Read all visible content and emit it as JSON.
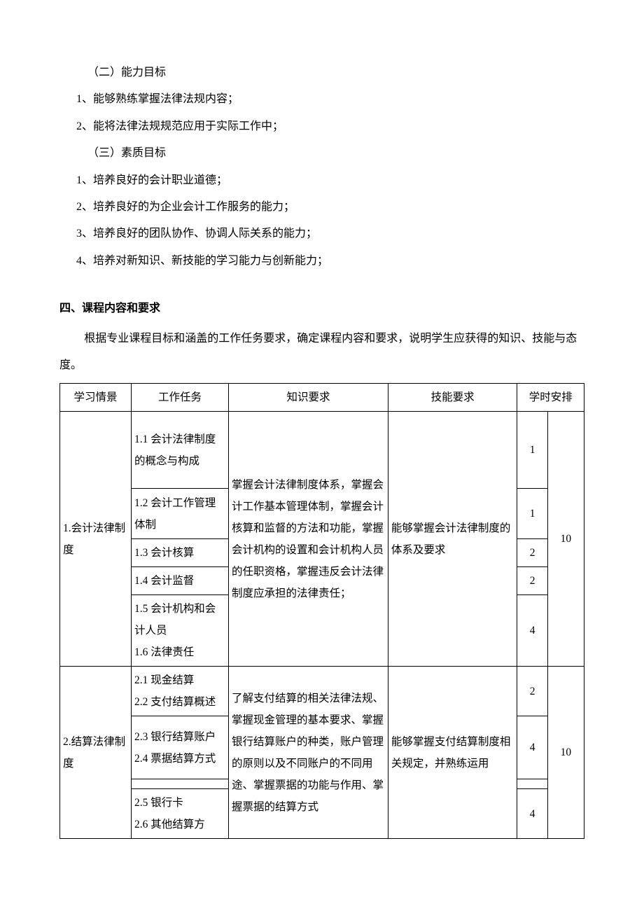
{
  "goals": {
    "ability_heading": "（二）能力目标",
    "ability_items": [
      "1、能够熟练掌握法律法规内容；",
      "2、能将法律法规规范应用于实际工作中；"
    ],
    "quality_heading": "（三）素质目标",
    "quality_items": [
      "1、培养良好的会计职业道德；",
      "2、培养良好的为企业会计工作服务的能力；",
      "3、培养良好的团队协作、协调人际关系的能力；",
      "4、培养对新知识、新技能的学习能力与创新能力；"
    ]
  },
  "section4": {
    "title": "四、课程内容和要求",
    "intro": "根据专业课程目标和涵盖的工作任务要求，确定课程内容和要求，说明学生应获得的知识、技能与态度。"
  },
  "table": {
    "headers": {
      "c1": "学习情景",
      "c2": "工作任务",
      "c3": "知识要求",
      "c4": "技能要求",
      "c5": "学时安排"
    },
    "group1": {
      "situation": "1.会计法律制度",
      "tasks": {
        "t1": "1.1 会计法律制度的概念与构成",
        "t2": "1.2 会计工作管理体制",
        "t3": "1.3 会计核算",
        "t4": "1.4 会计监督",
        "t5": "1.5 会计机构和会计人员\n1.6 法律责任"
      },
      "knowledge": "掌握会计法律制度体系，掌握会计工作基本管理体制，掌握会计核算和监督的方法和功能，掌握会计机构的设置和会计机构人员的任职资格，掌握违反会计法律制度应承担的法律责任；",
      "skill": "能够掌握会计法律制度的体系及要求",
      "hours": {
        "h1": "1",
        "h2": "1",
        "h3": "2",
        "h4": "2",
        "h5": "4"
      },
      "total": "10"
    },
    "group2": {
      "situation": "2.结算法律制度",
      "tasks": {
        "t1": "2.1 现金结算\n2.2 支付结算概述",
        "t2": "2.3 银行结算账户\n2.4 票据结算方式",
        "t3_blank": "",
        "t4": "2.5 银行卡\n2.6 其他结算方"
      },
      "knowledge": "了解支付结算的相关法律法规、掌握现金管理的基本要求、掌握银行结算账户的种类，账户管理的原则以及不同账户的不同用途、掌握票据的功能与作用、掌握票据的结算方式",
      "skill": "能够掌握支付结算制度相关规定，并熟练运用",
      "hours": {
        "h1": "2",
        "h2": "4",
        "h3_blank": "",
        "h4": "4"
      },
      "total": "10"
    }
  }
}
